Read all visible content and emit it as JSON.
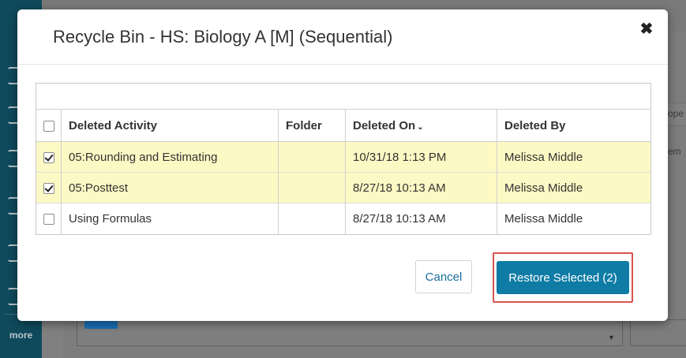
{
  "background": {
    "sidebar_more": "more",
    "right_text_1": "ope",
    "right_text_2": "em"
  },
  "modal": {
    "title": "Recycle Bin - HS: Biology A [M] (Sequential)",
    "close_icon": "close-icon"
  },
  "table": {
    "headers": {
      "activity": "Deleted Activity",
      "folder": "Folder",
      "deleted_on": "Deleted On",
      "deleted_by": "Deleted By"
    },
    "sort_caret": "⌄",
    "rows": [
      {
        "activity": "05:Rounding and Estimating",
        "folder": "",
        "deleted_on": "10/31/18 1:13 PM",
        "deleted_by": "Melissa Middle",
        "checked": true
      },
      {
        "activity": "05:Posttest",
        "folder": "",
        "deleted_on": "8/27/18 10:13 AM",
        "deleted_by": "Melissa Middle",
        "checked": true
      },
      {
        "activity": "Using Formulas",
        "folder": "",
        "deleted_on": "8/27/18 10:13 AM",
        "deleted_by": "Melissa Middle",
        "checked": false
      }
    ]
  },
  "buttons": {
    "cancel": "Cancel",
    "restore": "Restore Selected (2)"
  },
  "colors": {
    "accent": "#0e7ca5",
    "selected_row": "#fdf9c4",
    "highlight_border": "#d9534f"
  }
}
